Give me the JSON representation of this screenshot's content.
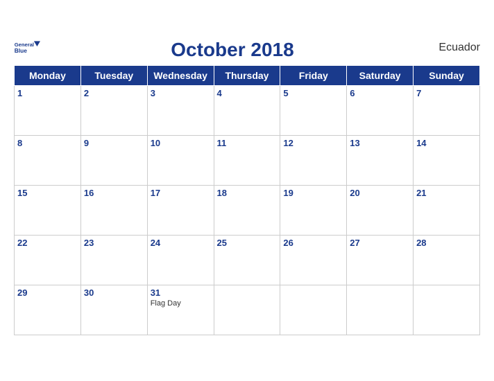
{
  "header": {
    "logo_line1": "General",
    "logo_line2": "Blue",
    "month_year": "October 2018",
    "country": "Ecuador"
  },
  "weekdays": [
    "Monday",
    "Tuesday",
    "Wednesday",
    "Thursday",
    "Friday",
    "Saturday",
    "Sunday"
  ],
  "weeks": [
    [
      {
        "day": 1,
        "holiday": ""
      },
      {
        "day": 2,
        "holiday": ""
      },
      {
        "day": 3,
        "holiday": ""
      },
      {
        "day": 4,
        "holiday": ""
      },
      {
        "day": 5,
        "holiday": ""
      },
      {
        "day": 6,
        "holiday": ""
      },
      {
        "day": 7,
        "holiday": ""
      }
    ],
    [
      {
        "day": 8,
        "holiday": ""
      },
      {
        "day": 9,
        "holiday": ""
      },
      {
        "day": 10,
        "holiday": ""
      },
      {
        "day": 11,
        "holiday": ""
      },
      {
        "day": 12,
        "holiday": ""
      },
      {
        "day": 13,
        "holiday": ""
      },
      {
        "day": 14,
        "holiday": ""
      }
    ],
    [
      {
        "day": 15,
        "holiday": ""
      },
      {
        "day": 16,
        "holiday": ""
      },
      {
        "day": 17,
        "holiday": ""
      },
      {
        "day": 18,
        "holiday": ""
      },
      {
        "day": 19,
        "holiday": ""
      },
      {
        "day": 20,
        "holiday": ""
      },
      {
        "day": 21,
        "holiday": ""
      }
    ],
    [
      {
        "day": 22,
        "holiday": ""
      },
      {
        "day": 23,
        "holiday": ""
      },
      {
        "day": 24,
        "holiday": ""
      },
      {
        "day": 25,
        "holiday": ""
      },
      {
        "day": 26,
        "holiday": ""
      },
      {
        "day": 27,
        "holiday": ""
      },
      {
        "day": 28,
        "holiday": ""
      }
    ],
    [
      {
        "day": 29,
        "holiday": ""
      },
      {
        "day": 30,
        "holiday": ""
      },
      {
        "day": 31,
        "holiday": "Flag Day"
      },
      {
        "day": null,
        "holiday": ""
      },
      {
        "day": null,
        "holiday": ""
      },
      {
        "day": null,
        "holiday": ""
      },
      {
        "day": null,
        "holiday": ""
      }
    ]
  ]
}
